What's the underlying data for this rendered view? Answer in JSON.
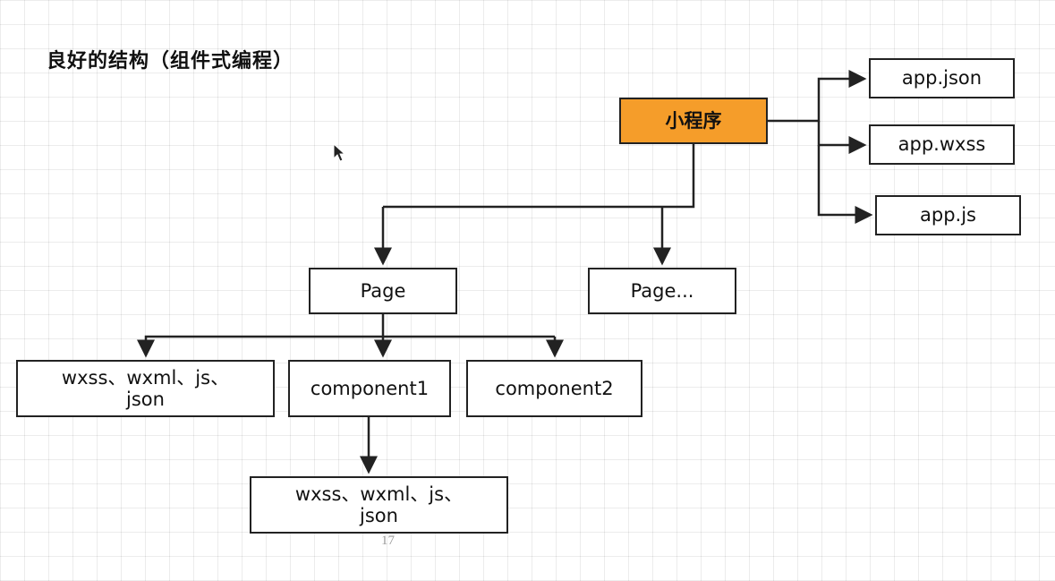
{
  "slide": {
    "title": "良好的结构（组件式编程）",
    "page_number": "17"
  },
  "nodes": {
    "root": "小程序",
    "app_json": "app.json",
    "app_wxss": "app.wxss",
    "app_js": "app.js",
    "page": "Page",
    "page_more": "Page...",
    "page_files_line1": "wxss、wxml、js、",
    "page_files_line2": "json",
    "component1": "component1",
    "component2": "component2",
    "component_files_line1": "wxss、wxml、js、",
    "component_files_line2": "json"
  },
  "colors": {
    "root_fill": "#f59d2a",
    "stroke": "#222222",
    "grid": "#e6e6e6"
  },
  "icons": {
    "cursor": "mouse-pointer-icon"
  }
}
